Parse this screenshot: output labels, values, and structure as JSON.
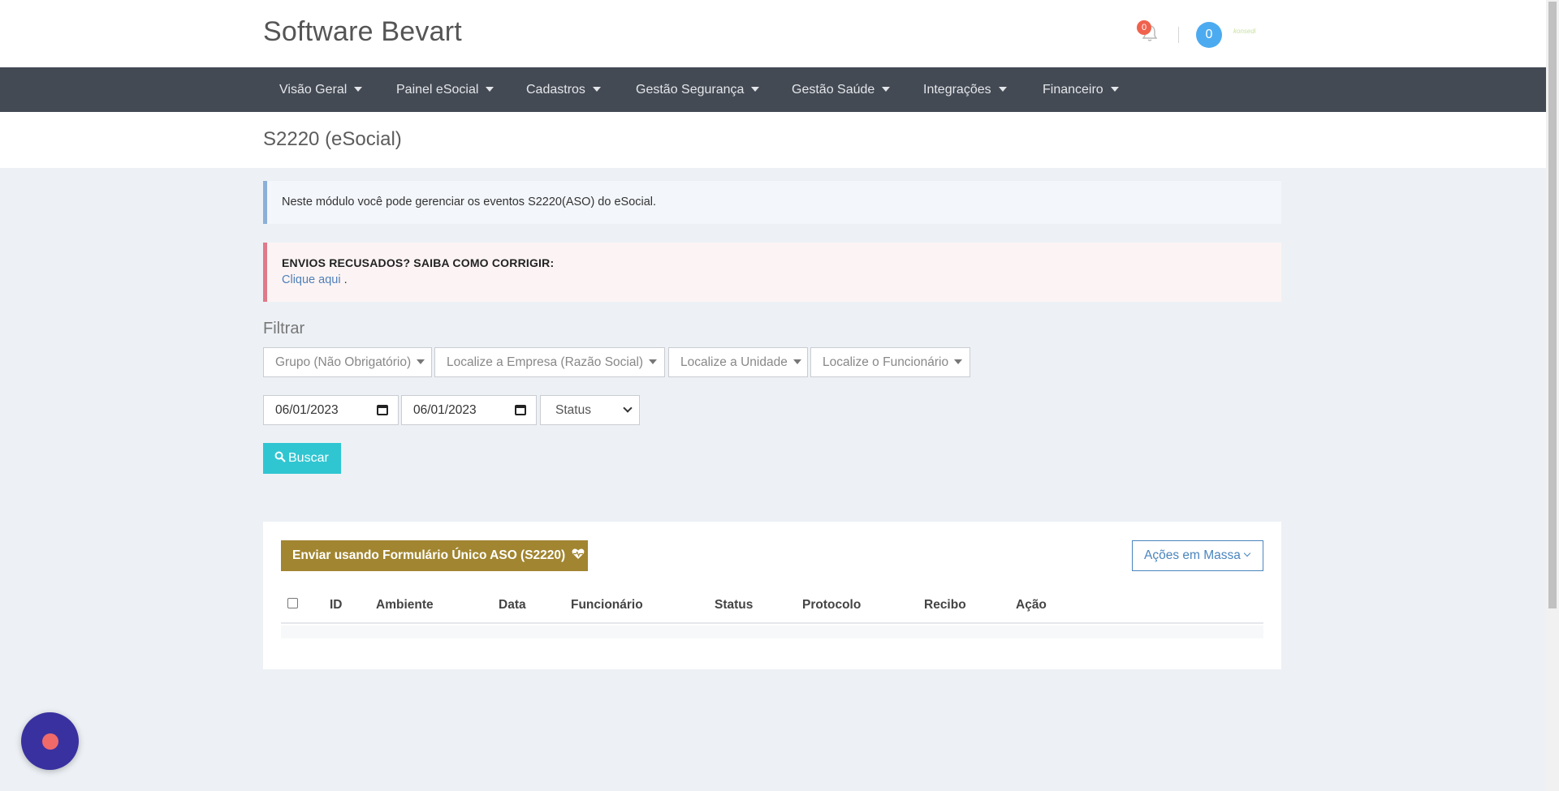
{
  "header": {
    "brand": "Software Bevart",
    "notification_count": "0",
    "avatar_label": "0",
    "user_logo_text": "konsedi"
  },
  "nav": {
    "items": [
      {
        "label": "Visão Geral"
      },
      {
        "label": "Painel eSocial"
      },
      {
        "label": "Cadastros"
      },
      {
        "label": "Gestão Segurança"
      },
      {
        "label": "Gestão Saúde"
      },
      {
        "label": "Integrações"
      },
      {
        "label": "Financeiro"
      }
    ]
  },
  "page": {
    "title": "S2220 (eSocial)"
  },
  "alerts": {
    "info": "Neste módulo você pode gerenciar os eventos S2220(ASO) do eSocial.",
    "danger_title": "ENVIOS RECUSADOS? SAIBA COMO CORRIGIR:",
    "danger_link": "Clique aqui",
    "danger_suffix": " ."
  },
  "filter": {
    "label": "Filtrar",
    "grupo": "Grupo (Não Obrigatório)",
    "empresa": "Localize a Empresa (Razão Social)",
    "unidade": "Localize a Unidade",
    "funcionario": "Localize o Funcionário",
    "date_start": "06/01/2023",
    "date_end": "06/01/2023",
    "status": "Status",
    "search_button": "Buscar"
  },
  "card": {
    "aso_button": "Enviar usando Formulário Único ASO (S2220)",
    "mass_actions_button": "Ações em Massa"
  },
  "table": {
    "columns": [
      "ID",
      "Ambiente",
      "Data",
      "Funcionário",
      "Status",
      "Protocolo",
      "Recibo",
      "Ação"
    ],
    "rows": []
  },
  "colors": {
    "navbar": "#434a54",
    "search_button": "#2fc6d2",
    "aso_button": "#a18530",
    "mass_button": "#4a85bd",
    "chat_widget": "#3a31a0"
  },
  "icons": {
    "bell": "bell-icon",
    "search": "search-icon",
    "heartbeat": "heartbeat-icon",
    "calendar": "calendar-icon",
    "chat": "chat-icon"
  }
}
